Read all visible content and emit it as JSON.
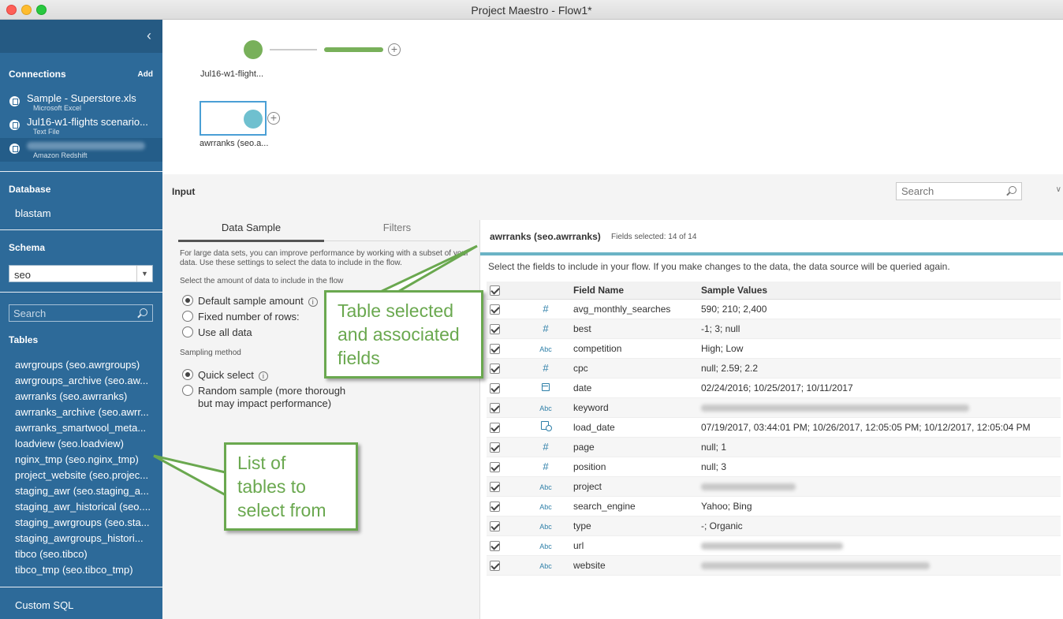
{
  "window": {
    "title": "Project Maestro - Flow1*"
  },
  "sidebar": {
    "connections": {
      "heading": "Connections",
      "add_label": "Add",
      "items": [
        {
          "name": "Sample - Superstore.xls",
          "type": "Microsoft Excel"
        },
        {
          "name": "Jul16-w1-flights scenario...",
          "type": "Text File"
        },
        {
          "name": "",
          "type": "Amazon Redshift"
        }
      ]
    },
    "database": {
      "heading": "Database",
      "value": "blastam"
    },
    "schema": {
      "heading": "Schema",
      "value": "seo"
    },
    "search": {
      "placeholder": "Search"
    },
    "tables": {
      "heading": "Tables",
      "items": [
        "awrgroups (seo.awrgroups)",
        "awrgroups_archive (seo.aw...",
        "awrranks (seo.awrranks)",
        "awrranks_archive (seo.awrr...",
        "awrranks_smartwool_meta...",
        "loadview (seo.loadview)",
        "nginx_tmp (seo.nginx_tmp)",
        "project_website (seo.projec...",
        "staging_awr (seo.staging_a...",
        "staging_awr_historical (seo....",
        "staging_awrgroups (seo.sta...",
        "staging_awrgroups_histori...",
        "tibco (seo.tibco)",
        "tibco_tmp (seo.tibco_tmp)"
      ]
    },
    "custom_sql": "Custom SQL"
  },
  "canvas": {
    "nodes": [
      {
        "label": "Jul16-w1-flight...",
        "color": "#78b05a"
      },
      {
        "label": "awrranks (seo.a...",
        "color": "#6fc0cf"
      }
    ]
  },
  "input_pane": {
    "title": "Input",
    "search_placeholder": "Search",
    "tabs": [
      "Data Sample",
      "Filters"
    ],
    "help_text": "For large data sets, you can improve performance by working with a subset of your data. Use these settings to select the data to include in the flow.",
    "amount_label": "Select the amount of data to include in the flow",
    "amount_options": [
      "Default sample amount",
      "Fixed number of rows:",
      "Use all data"
    ],
    "sampling_label": "Sampling method",
    "sampling_options": [
      "Quick select",
      "Random sample (more thorough",
      "but may impact performance)"
    ]
  },
  "fields_panel": {
    "title": "awrranks (seo.awrranks)",
    "fields_selected": "Fields selected: 14 of 14",
    "description": "Select the fields to include in your flow. If you make changes to the data, the data source will be queried again.",
    "columns": [
      "Field Name",
      "Sample Values"
    ],
    "rows": [
      {
        "type": "number",
        "name": "avg_monthly_searches",
        "values": "590; 210; 2,400"
      },
      {
        "type": "number",
        "name": "best",
        "values": "-1; 3; null"
      },
      {
        "type": "string",
        "name": "competition",
        "values": "High; Low"
      },
      {
        "type": "number",
        "name": "cpc",
        "values": "null; 2.59; 2.2"
      },
      {
        "type": "date",
        "name": "date",
        "values": "02/24/2016; 10/25/2017; 10/11/2017"
      },
      {
        "type": "string",
        "name": "keyword",
        "values": ""
      },
      {
        "type": "datetime",
        "name": "load_date",
        "values": "07/19/2017, 03:44:01 PM; 10/26/2017, 12:05:05 PM; 10/12/2017, 12:05:04 PM"
      },
      {
        "type": "number",
        "name": "page",
        "values": "null; 1"
      },
      {
        "type": "number",
        "name": "position",
        "values": "null; 3"
      },
      {
        "type": "string",
        "name": "project",
        "values": ""
      },
      {
        "type": "string",
        "name": "search_engine",
        "values": "Yahoo; Bing"
      },
      {
        "type": "string",
        "name": "type",
        "values": "-; Organic"
      },
      {
        "type": "string",
        "name": "url",
        "values": ""
      },
      {
        "type": "string",
        "name": "website",
        "values": ""
      }
    ],
    "type_glyphs": {
      "number": "#",
      "string": "Abc"
    }
  },
  "callouts": {
    "table": [
      "Table selected",
      "and associated",
      "fields"
    ],
    "list": [
      "List of",
      "tables to",
      "select from"
    ]
  },
  "colors": {
    "sidebar": "#2d6a99",
    "accent_green": "#6aa84f",
    "teal": "#6bb3c5"
  }
}
